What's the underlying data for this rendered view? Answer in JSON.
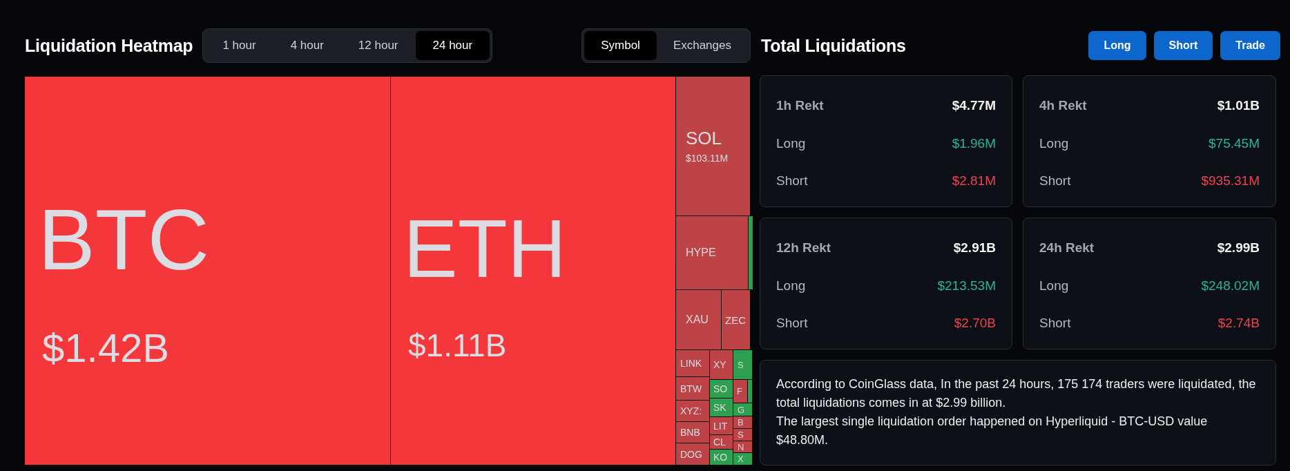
{
  "heatmap": {
    "title": "Liquidation Heatmap",
    "timeframes": [
      {
        "label": "1 hour",
        "selected": false
      },
      {
        "label": "4 hour",
        "selected": false
      },
      {
        "label": "12 hour",
        "selected": false
      },
      {
        "label": "24 hour",
        "selected": true
      }
    ],
    "views": [
      {
        "label": "Symbol",
        "selected": true
      },
      {
        "label": "Exchanges",
        "selected": false
      }
    ],
    "tiles": [
      {
        "symbol": "BTC",
        "value": "$1.42B",
        "color": "#f4373b"
      },
      {
        "symbol": "ETH",
        "value": "$1.11B",
        "color": "#f4373b"
      },
      {
        "symbol": "SOL",
        "value": "$103.11M",
        "color": "#be4347"
      },
      {
        "symbol": "HYPE",
        "color": "#be4347"
      },
      {
        "color": "#2e9f4f"
      },
      {
        "symbol": "XAU",
        "color": "#be4347"
      },
      {
        "symbol": "ZEC",
        "color": "#be4347"
      },
      {
        "symbol": "LINK",
        "color": "#be4347"
      },
      {
        "symbol": "BTW",
        "color": "#be4347"
      },
      {
        "symbol": "XYZ:",
        "color": "#be4347"
      },
      {
        "symbol": "BNB",
        "color": "#be4347"
      },
      {
        "symbol": "DOG",
        "color": "#be4347"
      },
      {
        "symbol": "XY",
        "color": "#be4347"
      },
      {
        "symbol": "SO",
        "color": "#2e9f4f"
      },
      {
        "symbol": "SK",
        "color": "#2e9f4f"
      },
      {
        "symbol": "LIT",
        "color": "#be4347"
      },
      {
        "symbol": "CL",
        "color": "#be4347"
      },
      {
        "symbol": "KO",
        "color": "#2e9f4f"
      },
      {
        "symbol": "S",
        "color": "#2e9f4f"
      },
      {
        "symbol": "F",
        "color": "#be4347"
      },
      {
        "color": "#2e9f4f"
      },
      {
        "symbol": "G",
        "color": "#2e9f4f"
      },
      {
        "symbol": "B",
        "color": "#be4347"
      },
      {
        "symbol": "S",
        "color": "#be4347"
      },
      {
        "symbol": "N",
        "color": "#be4347"
      },
      {
        "symbol": "X",
        "color": "#2e9f4f"
      }
    ]
  },
  "total_liquidations": {
    "title": "Total Liquidations",
    "buttons": [
      "Long",
      "Short",
      "Trade"
    ],
    "cards": [
      {
        "title": "1h Rekt",
        "total": "$4.77M",
        "rows": [
          {
            "kind": "long",
            "label": "Long",
            "value": "$1.96M"
          },
          {
            "kind": "short",
            "label": "Short",
            "value": "$2.81M"
          }
        ]
      },
      {
        "title": "4h Rekt",
        "total": "$1.01B",
        "rows": [
          {
            "kind": "long",
            "label": "Long",
            "value": "$75.45M"
          },
          {
            "kind": "short",
            "label": "Short",
            "value": "$935.31M"
          }
        ]
      },
      {
        "title": "12h Rekt",
        "total": "$2.91B",
        "rows": [
          {
            "kind": "long",
            "label": "Long",
            "value": "$213.53M"
          },
          {
            "kind": "short",
            "label": "Short",
            "value": "$2.70B"
          }
        ]
      },
      {
        "title": "24h Rekt",
        "total": "$2.99B",
        "rows": [
          {
            "kind": "long",
            "label": "Long",
            "value": "$248.02M"
          },
          {
            "kind": "short",
            "label": "Short",
            "value": "$2.74B"
          }
        ]
      }
    ],
    "summary": [
      "According to CoinGlass data, In the past 24 hours, 175 174 traders were liquidated, the total liquidations comes in at $2.99 billion.",
      "The largest single liquidation order happened on Hyperliquid - BTC-USD value $48.80M."
    ]
  }
}
